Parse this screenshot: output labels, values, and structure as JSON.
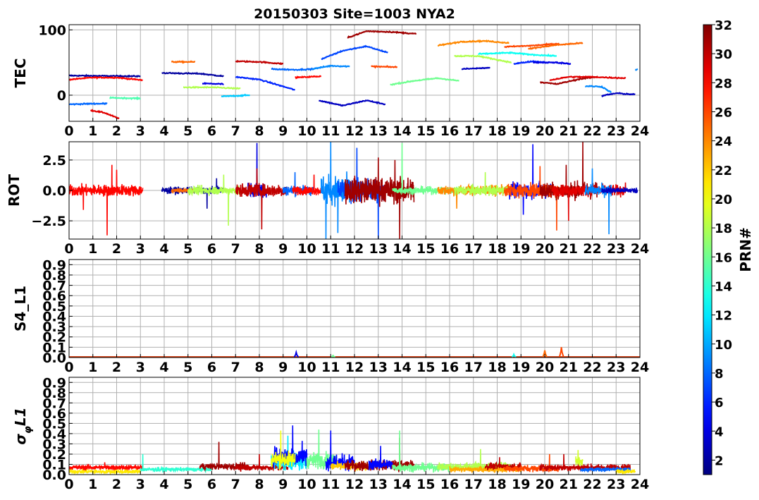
{
  "title": "20150303 Site=1003 NYA2",
  "colorbar": {
    "label": "PRN#",
    "min": 1,
    "max": 32,
    "ticks": [
      2,
      4,
      6,
      8,
      10,
      12,
      14,
      16,
      18,
      20,
      22,
      24,
      26,
      28,
      30,
      32
    ],
    "colormap": "jet"
  },
  "chart_data": [
    {
      "type": "line",
      "ylabel": "TEC",
      "xlim": [
        0,
        24
      ],
      "ylim": [
        -40,
        108
      ],
      "xticks": [
        0,
        1,
        2,
        3,
        4,
        5,
        6,
        7,
        8,
        9,
        10,
        11,
        12,
        13,
        14,
        15,
        16,
        17,
        18,
        19,
        20,
        21,
        22,
        23,
        24
      ],
      "yticks": [
        0,
        100
      ],
      "grid": true,
      "series": [
        {
          "prn": 2,
          "x": [
            0.0,
            3.0
          ],
          "y": [
            30,
            29
          ]
        },
        {
          "prn": 28,
          "x": [
            0.0,
            1.0,
            2.0,
            3.1
          ],
          "y": [
            24,
            27,
            27,
            23
          ]
        },
        {
          "prn": 8,
          "x": [
            0.0,
            1.0,
            1.6
          ],
          "y": [
            -14,
            -13,
            -13
          ]
        },
        {
          "prn": 29,
          "x": [
            0.9,
            1.5,
            2.1
          ],
          "y": [
            -23,
            -27,
            -36
          ]
        },
        {
          "prn": 15,
          "x": [
            1.7,
            3.0
          ],
          "y": [
            -4,
            -5
          ]
        },
        {
          "prn": 2,
          "x": [
            3.9,
            5.5,
            6.5
          ],
          "y": [
            34,
            33,
            29
          ]
        },
        {
          "prn": 25,
          "x": [
            4.3,
            5.3
          ],
          "y": [
            51,
            51
          ]
        },
        {
          "prn": 18,
          "x": [
            4.8,
            6.0,
            7.2
          ],
          "y": [
            12,
            12,
            10
          ]
        },
        {
          "prn": 4,
          "x": [
            5.6,
            6.5
          ],
          "y": [
            18,
            17
          ]
        },
        {
          "prn": 11,
          "x": [
            6.4,
            7.6
          ],
          "y": [
            -2,
            0
          ]
        },
        {
          "prn": 30,
          "x": [
            7.0,
            8.0,
            9.0
          ],
          "y": [
            52,
            51,
            48
          ]
        },
        {
          "prn": 6,
          "x": [
            7.0,
            8.0,
            9.5
          ],
          "y": [
            28,
            24,
            8
          ]
        },
        {
          "prn": 8,
          "x": [
            8.5,
            9.5,
            10.3
          ],
          "y": [
            40,
            39,
            40
          ]
        },
        {
          "prn": 28,
          "x": [
            9.5,
            10.6
          ],
          "y": [
            27,
            29
          ]
        },
        {
          "prn": 9,
          "x": [
            10.2,
            11.0,
            11.8
          ],
          "y": [
            40,
            45,
            44
          ]
        },
        {
          "prn": 3,
          "x": [
            10.5,
            11.5,
            12.5,
            13.3
          ],
          "y": [
            -8,
            -16,
            -8,
            -14
          ]
        },
        {
          "prn": 7,
          "x": [
            10.6,
            11.5,
            12.5,
            13.4
          ],
          "y": [
            55,
            68,
            75,
            65
          ]
        },
        {
          "prn": 31,
          "x": [
            11.7,
            12.5,
            13.5,
            14.6
          ],
          "y": [
            88,
            98,
            97,
            94
          ]
        },
        {
          "prn": 26,
          "x": [
            12.7,
            13.8
          ],
          "y": [
            44,
            43
          ]
        },
        {
          "prn": 16,
          "x": [
            13.5,
            14.5,
            15.5,
            16.4
          ],
          "y": [
            16,
            22,
            26,
            22
          ]
        },
        {
          "prn": 24,
          "x": [
            15.5,
            16.5,
            17.5,
            18.5
          ],
          "y": [
            76,
            82,
            83,
            80
          ]
        },
        {
          "prn": 18,
          "x": [
            16.2,
            17.2,
            18.6
          ],
          "y": [
            60,
            60,
            50
          ]
        },
        {
          "prn": 3,
          "x": [
            16.5,
            17.7
          ],
          "y": [
            40,
            42
          ]
        },
        {
          "prn": 13,
          "x": [
            17.2,
            18.5,
            19.5,
            20.5
          ],
          "y": [
            63,
            65,
            62,
            60
          ]
        },
        {
          "prn": 26,
          "x": [
            18.3,
            19.5,
            20.6
          ],
          "y": [
            74,
            76,
            79
          ]
        },
        {
          "prn": 6,
          "x": [
            18.7,
            19.5,
            20.2
          ],
          "y": [
            48,
            52,
            50
          ]
        },
        {
          "prn": 25,
          "x": [
            19.3,
            20.5,
            21.6
          ],
          "y": [
            71,
            77,
            80
          ]
        },
        {
          "prn": 4,
          "x": [
            19.5,
            20.5,
            21.1
          ],
          "y": [
            50,
            50,
            48
          ]
        },
        {
          "prn": 31,
          "x": [
            19.8,
            20.5,
            21.5,
            22.2
          ],
          "y": [
            20,
            17,
            25,
            28
          ]
        },
        {
          "prn": 29,
          "x": [
            20.2,
            21.0,
            22.0,
            23.4
          ],
          "y": [
            23,
            28,
            28,
            26
          ]
        },
        {
          "prn": 9,
          "x": [
            21.7,
            22.4,
            22.8
          ],
          "y": [
            14,
            13,
            4
          ]
        },
        {
          "prn": 3,
          "x": [
            22.4,
            23.0,
            23.8
          ],
          "y": [
            -1,
            3,
            1
          ]
        },
        {
          "prn": 9,
          "x": [
            23.8,
            23.9
          ],
          "y": [
            39,
            39
          ]
        }
      ]
    },
    {
      "type": "line",
      "ylabel": "ROT",
      "xlim": [
        0,
        24
      ],
      "ylim": [
        -4,
        4
      ],
      "xticks": [
        0,
        1,
        2,
        3,
        4,
        5,
        6,
        7,
        8,
        9,
        10,
        11,
        12,
        13,
        14,
        15,
        16,
        17,
        18,
        19,
        20,
        21,
        22,
        23,
        24
      ],
      "yticks": [
        -2.5,
        0.0,
        2.5
      ],
      "grid": true,
      "segments": [
        {
          "prn": 28,
          "t0": 0.0,
          "t1": 3.1,
          "amp": 0.8,
          "spikes": [
            [
              0.6,
              -1.6
            ],
            [
              1.6,
              -3.7
            ],
            [
              1.8,
              2.1
            ],
            [
              2.0,
              1.7
            ]
          ]
        },
        {
          "prn": 2,
          "t0": 3.9,
          "t1": 6.5,
          "amp": 0.45,
          "spikes": [
            [
              5.8,
              -1.5
            ],
            [
              6.2,
              1.0
            ]
          ]
        },
        {
          "prn": 25,
          "t0": 4.3,
          "t1": 5.3,
          "amp": 0.3,
          "spikes": []
        },
        {
          "prn": 18,
          "t0": 5.0,
          "t1": 7.2,
          "amp": 0.6,
          "spikes": [
            [
              6.7,
              -2.9
            ],
            [
              6.5,
              1.3
            ]
          ]
        },
        {
          "prn": 4,
          "t0": 7.5,
          "t1": 8.3,
          "amp": 1.2,
          "spikes": [
            [
              7.9,
              3.9
            ]
          ]
        },
        {
          "prn": 30,
          "t0": 7.0,
          "t1": 9.2,
          "amp": 0.9,
          "spikes": [
            [
              8.1,
              -3.2
            ],
            [
              7.9,
              1.8
            ]
          ]
        },
        {
          "prn": 8,
          "t0": 9.0,
          "t1": 10.3,
          "amp": 0.7,
          "spikes": [
            [
              9.5,
              1.5
            ]
          ]
        },
        {
          "prn": 28,
          "t0": 9.4,
          "t1": 10.6,
          "amp": 0.6,
          "spikes": [
            [
              10.3,
              1.3
            ]
          ]
        },
        {
          "prn": 9,
          "t0": 10.6,
          "t1": 11.8,
          "amp": 2.0,
          "spikes": [
            [
              10.8,
              -4.0
            ],
            [
              11.0,
              4.0
            ],
            [
              11.3,
              -3.5
            ]
          ]
        },
        {
          "prn": 7,
          "t0": 11.3,
          "t1": 13.2,
          "amp": 1.5,
          "spikes": [
            [
              12.1,
              3.5
            ],
            [
              13.0,
              -4.0
            ]
          ]
        },
        {
          "prn": 31,
          "t0": 11.6,
          "t1": 14.5,
          "amp": 1.8,
          "spikes": [
            [
              13.0,
              2.7
            ],
            [
              13.9,
              -4.0
            ],
            [
              13.7,
              2.5
            ]
          ]
        },
        {
          "prn": 16,
          "t0": 13.6,
          "t1": 16.4,
          "amp": 0.5,
          "spikes": [
            [
              14.0,
              3.9
            ]
          ]
        },
        {
          "prn": 24,
          "t0": 15.5,
          "t1": 18.6,
          "amp": 0.7,
          "spikes": [
            [
              16.3,
              -1.5
            ]
          ]
        },
        {
          "prn": 18,
          "t0": 16.2,
          "t1": 18.6,
          "amp": 0.7,
          "spikes": [
            [
              17.5,
              1.5
            ]
          ]
        },
        {
          "prn": 5,
          "t0": 18.5,
          "t1": 20.3,
          "amp": 1.1,
          "spikes": [
            [
              19.5,
              3.8
            ],
            [
              19.1,
              -2.0
            ]
          ]
        },
        {
          "prn": 26,
          "t0": 18.3,
          "t1": 20.6,
          "amp": 1.0,
          "spikes": [
            [
              19.8,
              2.0
            ],
            [
              20.5,
              -3.3
            ]
          ]
        },
        {
          "prn": 31,
          "t0": 19.8,
          "t1": 22.2,
          "amp": 1.2,
          "spikes": [
            [
              21.6,
              4.0
            ],
            [
              20.9,
              2.1
            ]
          ]
        },
        {
          "prn": 29,
          "t0": 20.3,
          "t1": 23.4,
          "amp": 0.8,
          "spikes": [
            [
              21.0,
              -2.5
            ]
          ]
        },
        {
          "prn": 9,
          "t0": 21.7,
          "t1": 22.8,
          "amp": 0.8,
          "spikes": [
            [
              22.7,
              -3.6
            ],
            [
              22.0,
              1.8
            ]
          ]
        },
        {
          "prn": 3,
          "t0": 22.4,
          "t1": 23.9,
          "amp": 0.4,
          "spikes": []
        }
      ]
    },
    {
      "type": "line",
      "ylabel": "S4_L1",
      "xlim": [
        0,
        24
      ],
      "ylim": [
        0,
        0.95
      ],
      "xticks": [
        0,
        1,
        2,
        3,
        4,
        5,
        6,
        7,
        8,
        9,
        10,
        11,
        12,
        13,
        14,
        15,
        16,
        17,
        18,
        19,
        20,
        21,
        22,
        23,
        24
      ],
      "yticks": [
        0.0,
        0.1,
        0.2,
        0.3,
        0.4,
        0.5,
        0.6,
        0.7,
        0.8,
        0.9
      ],
      "grid": true,
      "baseline": 0.005,
      "spikes": [
        {
          "prn": 4,
          "x": 9.55,
          "y": 0.05
        },
        {
          "prn": 16,
          "x": 11.1,
          "y": 0.02
        },
        {
          "prn": 13,
          "x": 18.7,
          "y": 0.03
        },
        {
          "prn": 25,
          "x": 20.0,
          "y": 0.07
        },
        {
          "prn": 26,
          "x": 20.7,
          "y": 0.1
        }
      ]
    },
    {
      "type": "line",
      "ylabel": "σφL1",
      "xlim": [
        0,
        24
      ],
      "ylim": [
        0,
        0.95
      ],
      "xticks": [
        0,
        1,
        2,
        3,
        4,
        5,
        6,
        7,
        8,
        9,
        10,
        11,
        12,
        13,
        14,
        15,
        16,
        17,
        18,
        19,
        20,
        21,
        22,
        23,
        24
      ],
      "yticks": [
        0.0,
        0.1,
        0.2,
        0.3,
        0.4,
        0.5,
        0.6,
        0.7,
        0.8,
        0.9
      ],
      "grid": true,
      "segments": [
        {
          "prn": 28,
          "t0": 0.0,
          "t1": 3.1,
          "base": 0.07,
          "amp": 0.04,
          "spikes": [
            [
              1.5,
              0.12
            ]
          ]
        },
        {
          "prn": 21,
          "t0": 0.0,
          "t1": 3.0,
          "base": 0.03,
          "amp": 0.03,
          "spikes": []
        },
        {
          "prn": 14,
          "t0": 3.0,
          "t1": 6.0,
          "base": 0.05,
          "amp": 0.03,
          "spikes": [
            [
              3.1,
              0.2
            ]
          ]
        },
        {
          "prn": 31,
          "t0": 5.5,
          "t1": 7.5,
          "base": 0.08,
          "amp": 0.05,
          "spikes": [
            [
              6.3,
              0.32
            ]
          ]
        },
        {
          "prn": 30,
          "t0": 7.0,
          "t1": 9.2,
          "base": 0.07,
          "amp": 0.05,
          "spikes": [
            [
              8.0,
              0.2
            ]
          ]
        },
        {
          "prn": 12,
          "t0": 8.5,
          "t1": 10.0,
          "base": 0.13,
          "amp": 0.14,
          "spikes": [
            [
              9.2,
              0.38
            ]
          ]
        },
        {
          "prn": 5,
          "t0": 8.6,
          "t1": 10.0,
          "base": 0.18,
          "amp": 0.14,
          "spikes": [
            [
              9.4,
              0.48
            ],
            [
              9.8,
              0.33
            ]
          ]
        },
        {
          "prn": 20,
          "t0": 8.5,
          "t1": 9.5,
          "base": 0.15,
          "amp": 0.12,
          "spikes": [
            [
              8.9,
              0.43
            ]
          ]
        },
        {
          "prn": 16,
          "t0": 10.0,
          "t1": 11.2,
          "base": 0.14,
          "amp": 0.12,
          "spikes": [
            [
              10.5,
              0.44
            ]
          ]
        },
        {
          "prn": 5,
          "t0": 10.8,
          "t1": 12.0,
          "base": 0.12,
          "amp": 0.12,
          "spikes": [
            [
              11.0,
              0.43
            ]
          ]
        },
        {
          "prn": 22,
          "t0": 11.0,
          "t1": 12.8,
          "base": 0.08,
          "amp": 0.06,
          "spikes": []
        },
        {
          "prn": 31,
          "t0": 11.6,
          "t1": 14.5,
          "base": 0.09,
          "amp": 0.08,
          "spikes": [
            [
              13.9,
              0.36
            ]
          ]
        },
        {
          "prn": 5,
          "t0": 12.6,
          "t1": 13.6,
          "base": 0.1,
          "amp": 0.08,
          "spikes": [
            [
              13.1,
              0.28
            ]
          ]
        },
        {
          "prn": 16,
          "t0": 13.6,
          "t1": 16.4,
          "base": 0.07,
          "amp": 0.06,
          "spikes": [
            [
              13.9,
              0.43
            ]
          ]
        },
        {
          "prn": 18,
          "t0": 15.5,
          "t1": 18.6,
          "base": 0.08,
          "amp": 0.06,
          "spikes": [
            [
              17.3,
              0.25
            ]
          ]
        },
        {
          "prn": 23,
          "t0": 16.0,
          "t1": 19.0,
          "base": 0.05,
          "amp": 0.04,
          "spikes": []
        },
        {
          "prn": 30,
          "t0": 17.5,
          "t1": 19.0,
          "base": 0.08,
          "amp": 0.05,
          "spikes": [
            [
              18.1,
              0.17
            ]
          ]
        },
        {
          "prn": 26,
          "t0": 18.3,
          "t1": 20.6,
          "base": 0.06,
          "amp": 0.05,
          "spikes": [
            [
              20.2,
              0.2
            ]
          ]
        },
        {
          "prn": 19,
          "t0": 21.3,
          "t1": 21.6,
          "base": 0.12,
          "amp": 0.1,
          "spikes": [
            [
              21.4,
              0.24
            ]
          ]
        },
        {
          "prn": 30,
          "t0": 19.8,
          "t1": 23.6,
          "base": 0.07,
          "amp": 0.05,
          "spikes": [
            [
              20.8,
              0.2
            ]
          ]
        },
        {
          "prn": 8,
          "t0": 21.5,
          "t1": 23.6,
          "base": 0.05,
          "amp": 0.03,
          "spikes": []
        },
        {
          "prn": 21,
          "t0": 23.0,
          "t1": 23.8,
          "base": 0.03,
          "amp": 0.03,
          "spikes": []
        }
      ]
    }
  ]
}
